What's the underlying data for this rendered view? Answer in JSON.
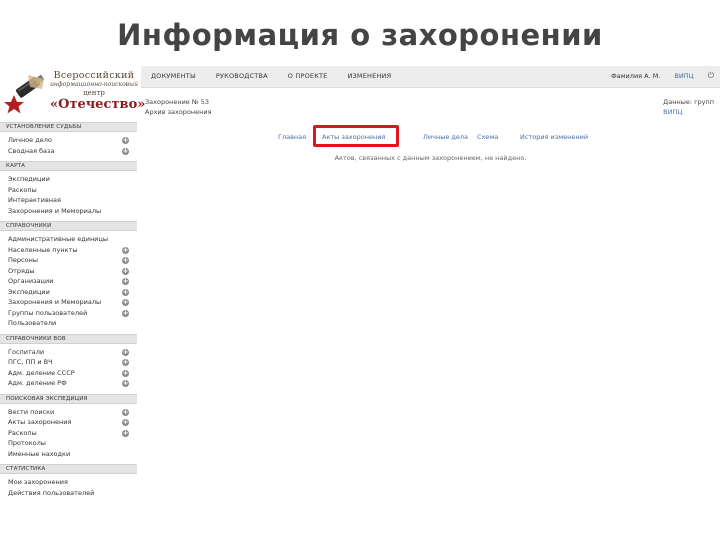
{
  "slide": {
    "title": "Информация о захоронении"
  },
  "logo": {
    "line1": "Всероссийский",
    "line2": "информационно-поисковый",
    "line3": "центр",
    "line4": "«Отечество»"
  },
  "topnav": {
    "items": [
      "ДОКУМЕНТЫ",
      "РУКОВОДСТВА",
      "О ПРОЕКТЕ",
      "ИЗМЕНЕНИЯ"
    ],
    "user": "Фамилия А. М.",
    "org": "ВИПЦ",
    "exit_icon": "power-icon"
  },
  "sidebar": {
    "sections": [
      {
        "title": "УСТАНОВЛЕНИЕ СУДЬБЫ",
        "items": [
          {
            "label": "Личное дело",
            "plus": true
          },
          {
            "label": "Сводная база",
            "plus": true
          }
        ]
      },
      {
        "title": "КАРТА",
        "items": [
          {
            "label": "Экспедиции",
            "plus": false
          },
          {
            "label": "Раскопы",
            "plus": false
          },
          {
            "label": "Интерактивная",
            "plus": false
          },
          {
            "label": "Захоронения и Мемориалы",
            "plus": false
          }
        ]
      },
      {
        "title": "СПРАВОЧНИКИ",
        "items": [
          {
            "label": "Административные единицы",
            "plus": false
          },
          {
            "label": "Населенные пункты",
            "plus": true
          },
          {
            "label": "Персоны",
            "plus": true
          },
          {
            "label": "Отряды",
            "plus": true
          },
          {
            "label": "Организации",
            "plus": true
          },
          {
            "label": "Экспедиции",
            "plus": true
          },
          {
            "label": "Захоронения и Мемориалы",
            "plus": true
          },
          {
            "label": "Группы пользователей",
            "plus": true
          },
          {
            "label": "Пользователи",
            "plus": false
          }
        ]
      },
      {
        "title": "СПРАВОЧНИКИ ВОВ",
        "items": [
          {
            "label": "Госпитали",
            "plus": true
          },
          {
            "label": "ПГС, ПП и ВЧ",
            "plus": true
          },
          {
            "label": "Адм. деление СССР",
            "plus": true
          },
          {
            "label": "Адм. деление РФ",
            "plus": true
          }
        ]
      },
      {
        "title": "ПОИСКОВАЯ ЭКСПЕДИЦИЯ",
        "items": [
          {
            "label": "Вести поиски",
            "plus": true
          },
          {
            "label": "Акты захоронения",
            "plus": true
          },
          {
            "label": "Раскопы",
            "plus": true
          },
          {
            "label": "Протоколы",
            "plus": false
          },
          {
            "label": "Именные находки",
            "plus": false
          }
        ]
      },
      {
        "title": "СТАТИСТИКА",
        "items": [
          {
            "label": "Мои захоронения",
            "plus": false
          },
          {
            "label": "Действия пользователей",
            "plus": false
          }
        ]
      }
    ]
  },
  "main": {
    "crumb_line1": "Захоронение № 53",
    "crumb_line2": "Архив захоронения",
    "right_line1": "Данные: групп",
    "right_line2": "ВИПЦ",
    "tabs": [
      "Главная",
      "Акты захоронения",
      "Личные дела",
      "Схема",
      "История изменений"
    ],
    "active_tab": "Акты захоронения",
    "empty_message": "Актов, связанных с данным захоронением, не найдено."
  },
  "colors": {
    "highlight": "#e0141c",
    "link": "#4a6fa5",
    "header_bg": "#ececec"
  }
}
